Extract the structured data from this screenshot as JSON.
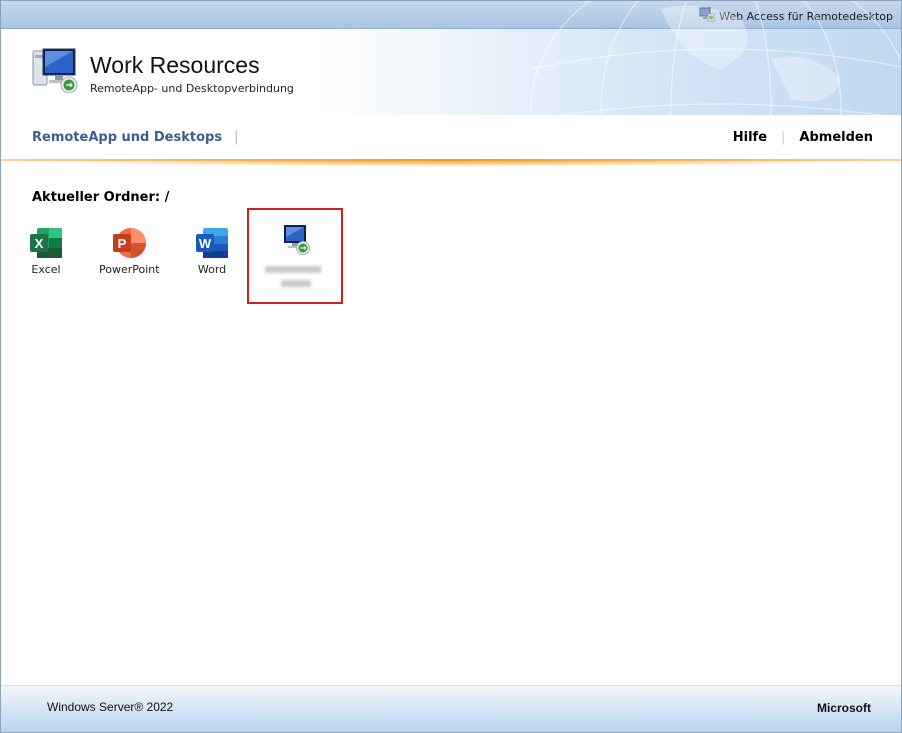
{
  "topbar": {
    "link": "Web Access für Remotedesktop"
  },
  "header": {
    "title": "Work Resources",
    "subtitle": "RemoteApp- und Desktopverbindung"
  },
  "nav": {
    "tab": "RemoteApp und Desktops",
    "help": "Hilfe",
    "logout": "Abmelden"
  },
  "folder": {
    "label": "Aktueller Ordner: /"
  },
  "apps": [
    {
      "label": "Excel",
      "icon": "excel-icon"
    },
    {
      "label": "PowerPoint",
      "icon": "powerpoint-icon"
    },
    {
      "label": "Word",
      "icon": "word-icon"
    },
    {
      "label": "",
      "icon": "remote-desktop-icon"
    }
  ],
  "footer": {
    "os": "Windows Server® 2022",
    "brand": "Microsoft"
  },
  "colors": {
    "excel": "#1e7145",
    "powerpoint": "#c43e1c",
    "word": "#185abd",
    "accent": "#3b5e8c",
    "selection": "#d02020"
  }
}
